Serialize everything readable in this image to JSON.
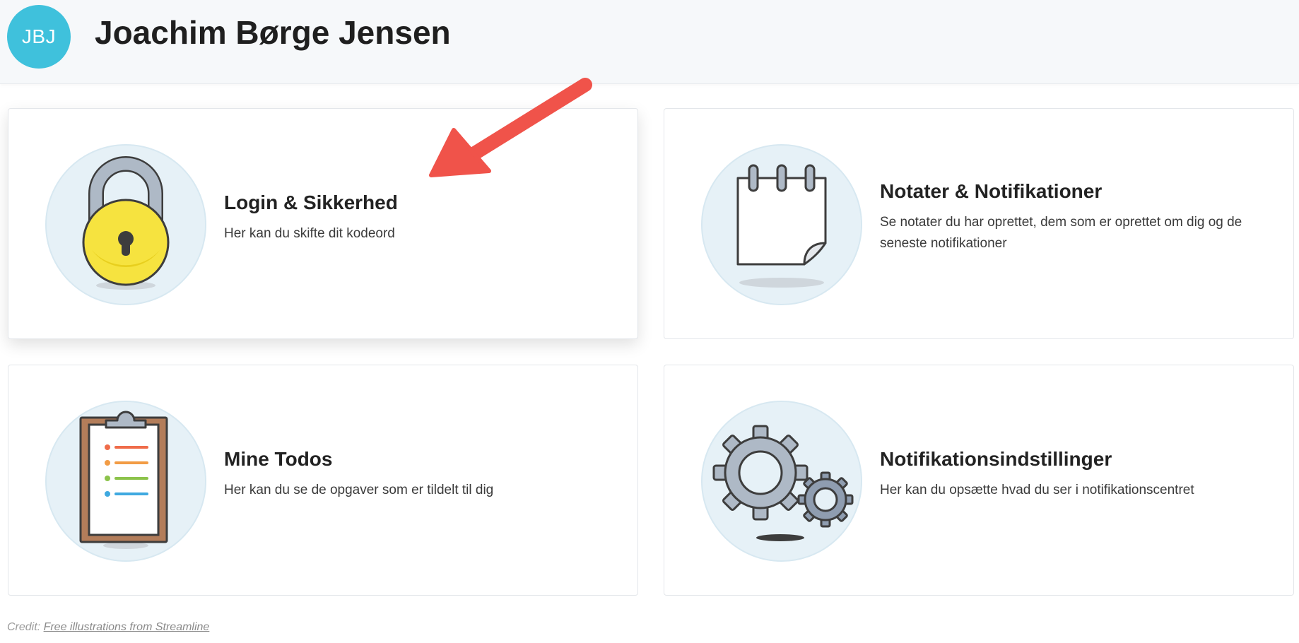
{
  "header": {
    "avatar_initials": "JBJ",
    "user_name": "Joachim Børge Jensen",
    "avatar_color": "#3fc1dc"
  },
  "cards": [
    {
      "title": "Login & Sikkerhed",
      "description": "Her kan du skifte dit kodeord",
      "icon": "padlock-icon"
    },
    {
      "title": "Notater & Notifikationer",
      "description": "Se notater du har oprettet, dem som er oprettet om dig og de seneste notifikationer",
      "icon": "notepad-icon"
    },
    {
      "title": "Mine Todos",
      "description": "Her kan du se de opgaver som er tildelt til dig",
      "icon": "clipboard-icon"
    },
    {
      "title": "Notifikationsindstillinger",
      "description": "Her kan du opsætte hvad du ser i notifikationscentret",
      "icon": "gears-icon"
    }
  ],
  "credit": {
    "prefix": "Credit:",
    "link_text": "Free illustrations from Streamline"
  },
  "annotation": {
    "arrow_color": "#f0534a"
  }
}
